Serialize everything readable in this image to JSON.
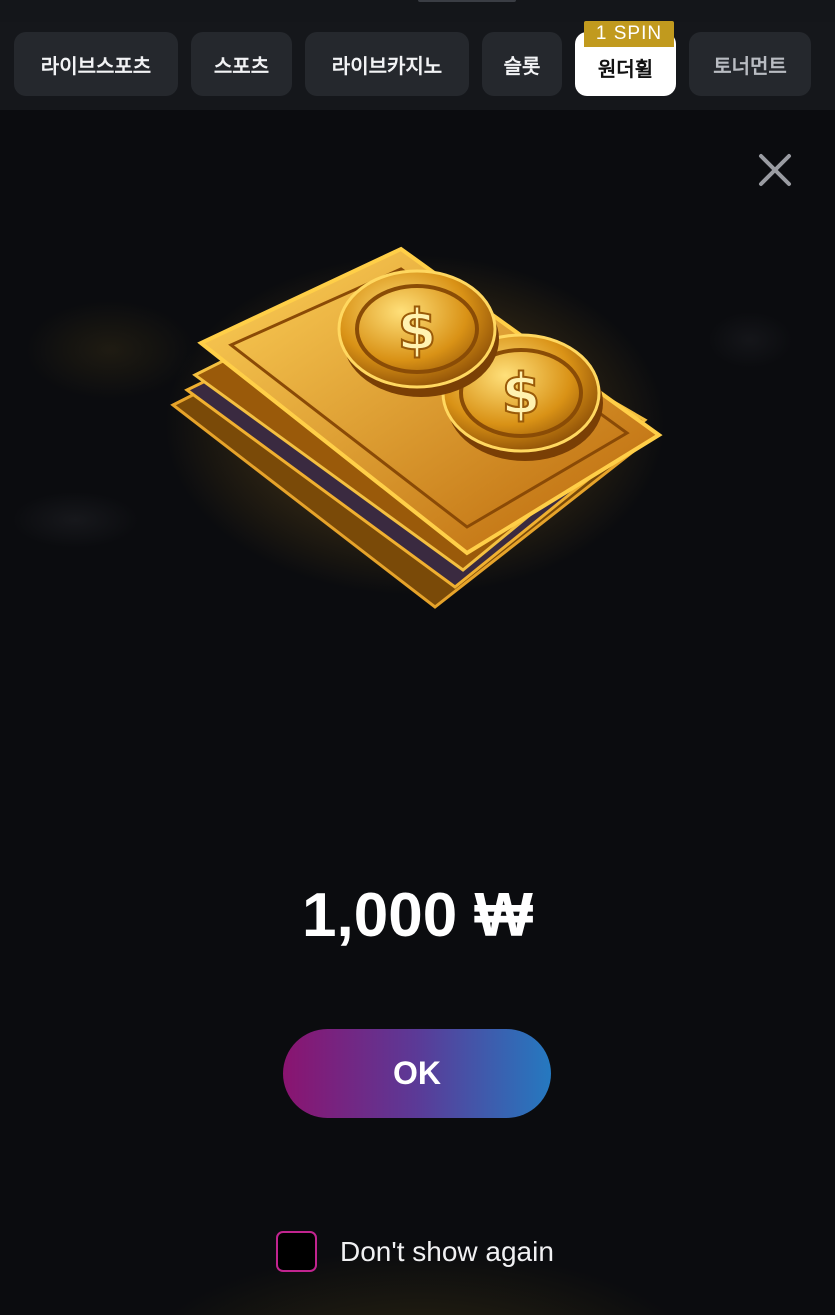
{
  "tabs": [
    {
      "label": "라이브스포츠",
      "active": false
    },
    {
      "label": "스포츠",
      "active": false
    },
    {
      "label": "라이브카지노",
      "active": false
    },
    {
      "label": "슬롯",
      "active": false
    },
    {
      "label": "원더휠",
      "active": true
    },
    {
      "label": "토너먼트",
      "active": false
    }
  ],
  "badge": {
    "label": "1 SPIN",
    "color": "#c19a1e"
  },
  "modal": {
    "close_icon": "close-icon",
    "reward_image": "gold-cash-coins-icon",
    "amount": "1,000 ₩",
    "ok_label": "OK",
    "dont_show_again_label": "Don't show again",
    "dont_show_again_checked": false
  },
  "colors": {
    "background": "#0c0d10",
    "ok_gradient_start": "#8a1470",
    "ok_gradient_end": "#2579c0",
    "checkbox_border": "#c1248f"
  }
}
